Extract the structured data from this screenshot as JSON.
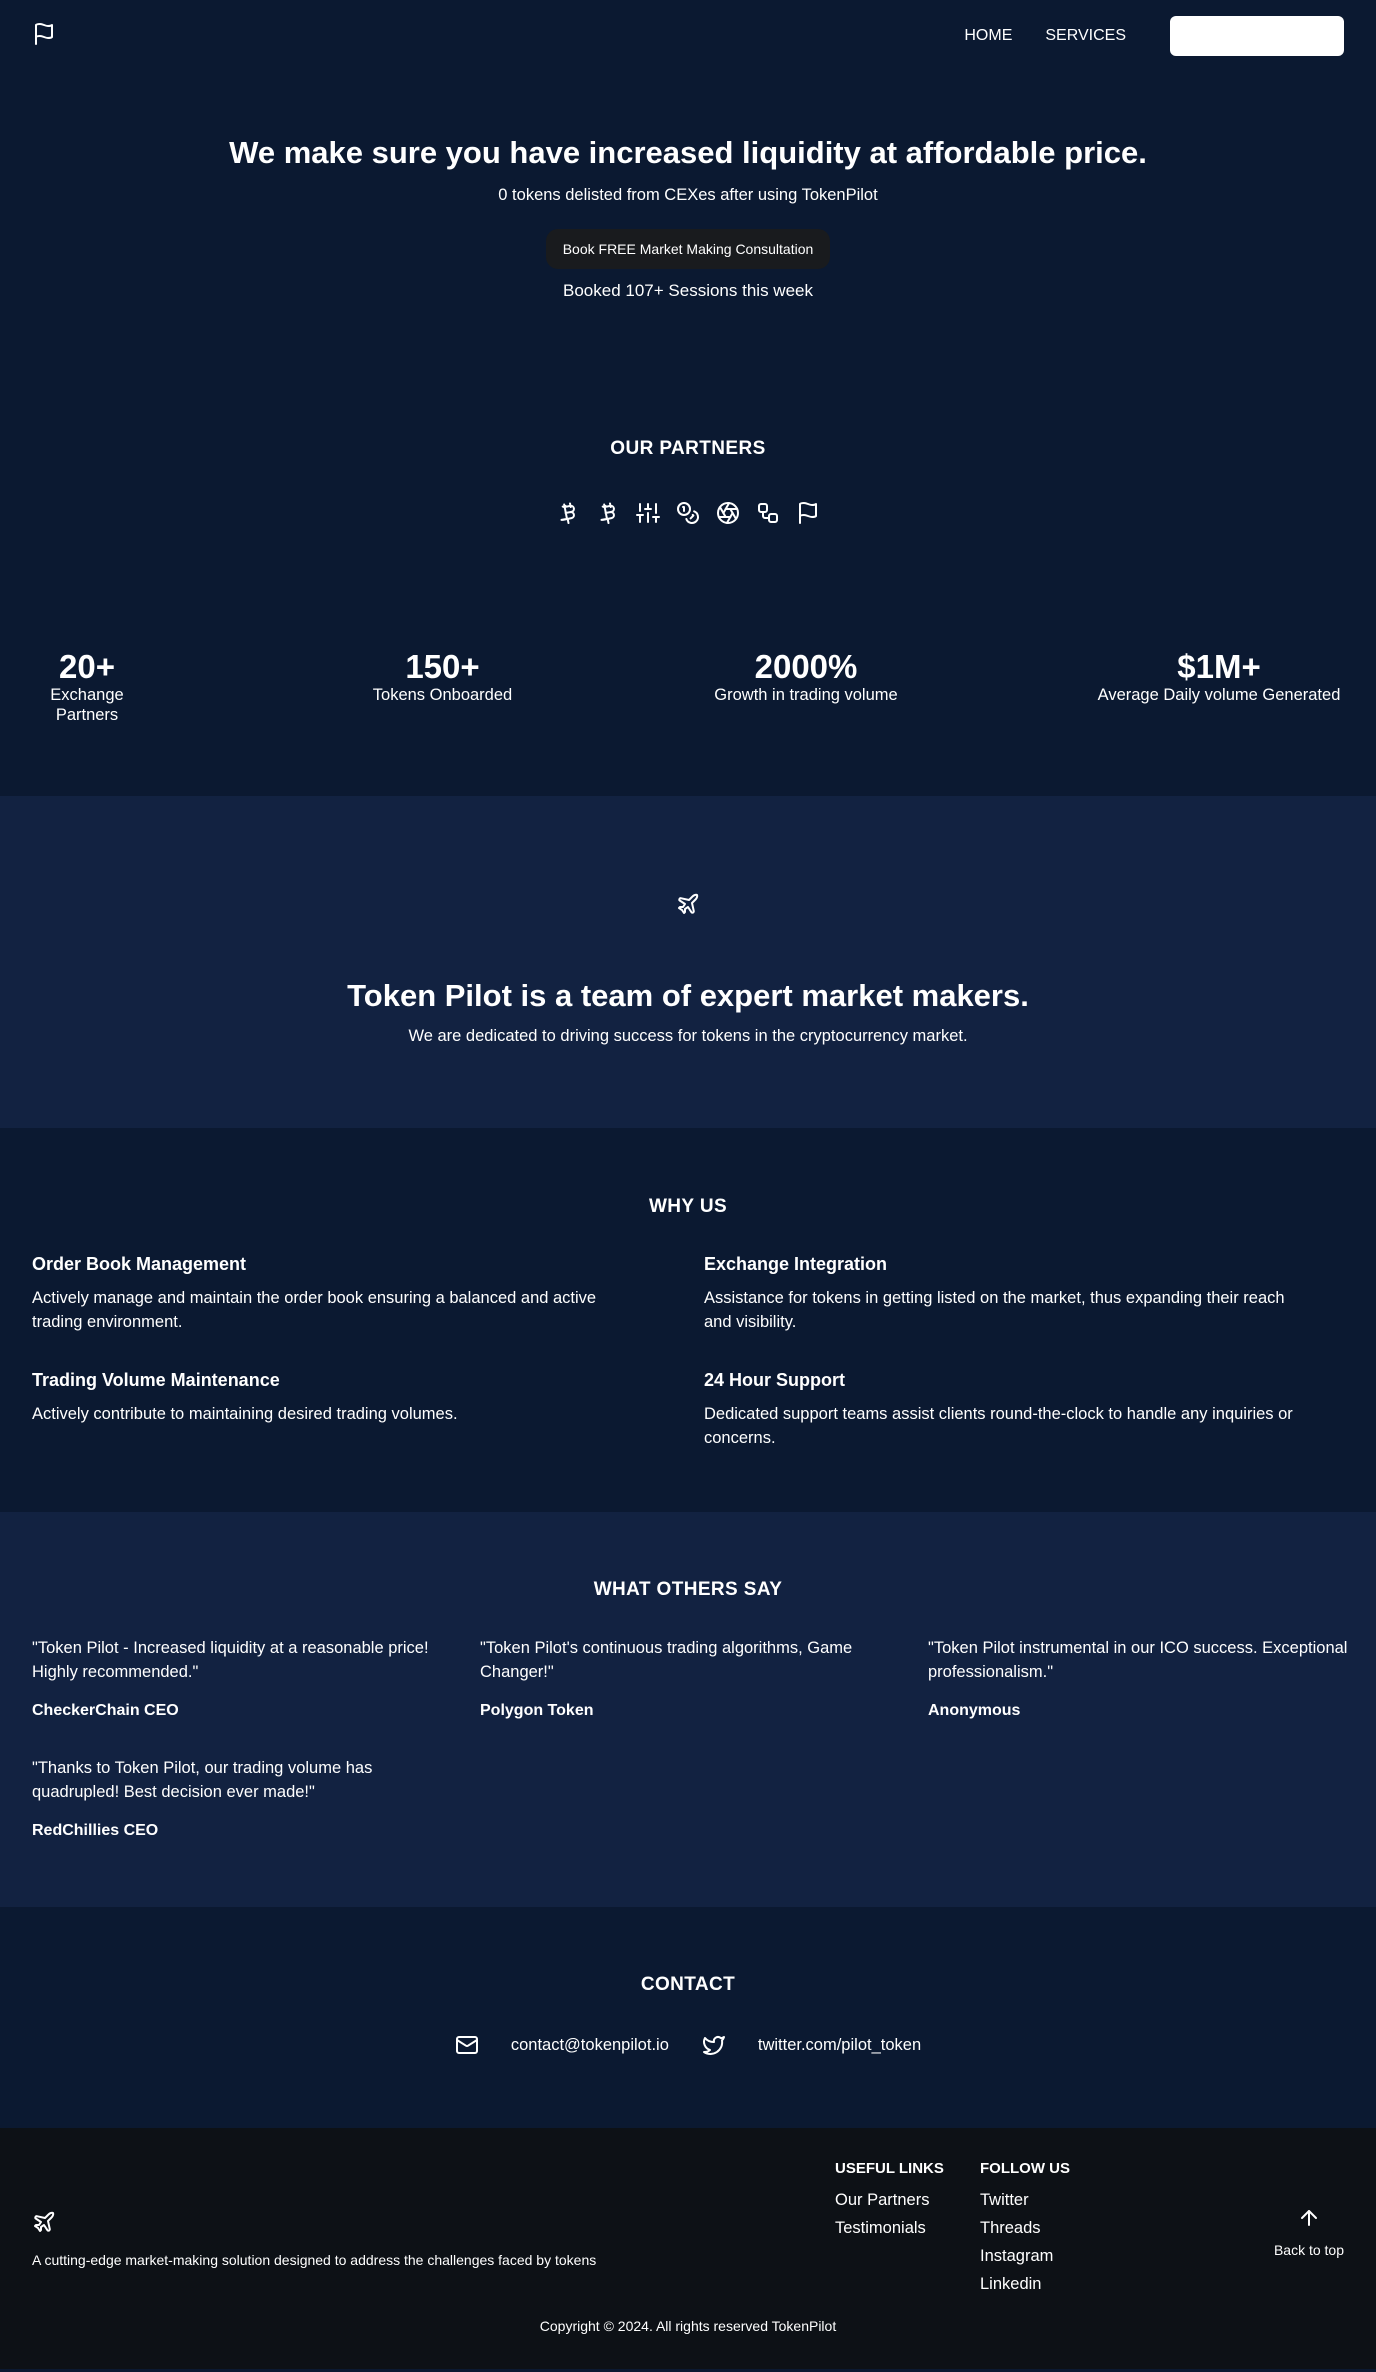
{
  "header": {
    "logo_icon": "flag-icon",
    "nav": [
      {
        "label": "HOME"
      },
      {
        "label": "SERVICES"
      }
    ],
    "cta_label": ""
  },
  "hero": {
    "title": "We make sure you have increased liquidity at affordable price.",
    "subtitle": "0 tokens delisted from CEXes after using TokenPilot",
    "button": "Book FREE Market Making Consultation",
    "booked": "Booked 107+ Sessions this week"
  },
  "partners": {
    "title": "OUR PARTNERS",
    "icons": [
      "bitcoin-icon",
      "bitcoin-icon",
      "sliders-icon",
      "coins-icon",
      "aperture-icon",
      "workflow-icon",
      "flag-icon"
    ]
  },
  "stats": [
    {
      "value": "20+",
      "label": "Exchange Partners"
    },
    {
      "value": "150+",
      "label": "Tokens Onboarded"
    },
    {
      "value": "2000%",
      "label": "Growth in trading volume"
    },
    {
      "value": "$1M+",
      "label": "Average Daily volume Generated"
    }
  ],
  "about": {
    "icon": "rocket-icon",
    "title": "Token Pilot is a team of expert market makers.",
    "text": "We are dedicated to driving success for tokens in the cryptocurrency market."
  },
  "why": {
    "title": "WHY US",
    "features": [
      {
        "title": "Order Book Management",
        "text": "Actively manage and maintain the order book ensuring a balanced and active trading environment."
      },
      {
        "title": "Exchange Integration",
        "text": "Assistance for tokens in getting listed on the market, thus expanding their reach and visibility."
      },
      {
        "title": "Trading Volume Maintenance",
        "text": "Actively contribute to maintaining desired trading volumes."
      },
      {
        "title": "24 Hour Support",
        "text": "Dedicated support teams assist clients round-the-clock to handle any inquiries or concerns."
      }
    ]
  },
  "testimonials": {
    "title": "WHAT OTHERS SAY",
    "items": [
      {
        "quote": "\"Token Pilot - Increased liquidity at a reasonable price! Highly recommended.\"",
        "author": "CheckerChain CEO"
      },
      {
        "quote": "\"Token Pilot's continuous trading algorithms, Game Changer!\"",
        "author": "Polygon Token"
      },
      {
        "quote": "\"Token Pilot instrumental in our ICO success. Exceptional professionalism.\"",
        "author": "Anonymous"
      },
      {
        "quote": "\"Thanks to Token Pilot, our trading volume has quadrupled! Best decision ever made!\"",
        "author": "RedChillies CEO"
      }
    ]
  },
  "contact": {
    "title": "CONTACT",
    "email": "contact@tokenpilot.io",
    "twitter": "twitter.com/pilot_token"
  },
  "footer": {
    "description": "A cutting-edge market-making solution designed to address the challenges faced by tokens",
    "useful_links": {
      "title": "USEFUL LINKS",
      "links": [
        "Our Partners",
        "Testimonials"
      ]
    },
    "follow_us": {
      "title": "FOLLOW US",
      "links": [
        "Twitter",
        "Threads",
        "Instagram",
        "Linkedin"
      ]
    },
    "back_to_top": "Back to top",
    "copyright": "Copyright © 2024. All rights reserved TokenPilot"
  },
  "colors": {
    "background": "#0b1931",
    "section_alt": "#122241",
    "footer": "#0d1116",
    "hero_button": "#191b1e",
    "text": "#ffffff"
  }
}
